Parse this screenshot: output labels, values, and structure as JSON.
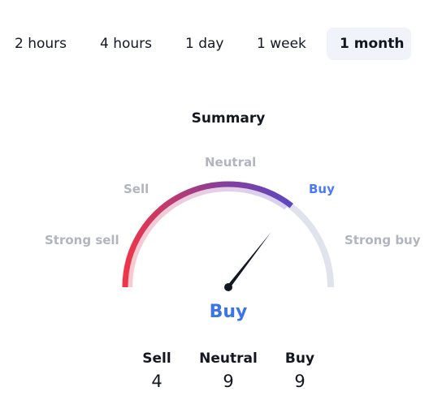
{
  "tabs": [
    {
      "label": "2 hours",
      "active": false
    },
    {
      "label": "4 hours",
      "active": false
    },
    {
      "label": "1 day",
      "active": false
    },
    {
      "label": "1 week",
      "active": false
    },
    {
      "label": "1 month",
      "active": true
    }
  ],
  "summary": {
    "title": "Summary",
    "gauge_labels": {
      "strong_sell": "Strong sell",
      "sell": "Sell",
      "neutral": "Neutral",
      "buy": "Buy",
      "strong_buy": "Strong buy"
    },
    "active_label": "buy",
    "needle_fraction": 0.71,
    "verdict": "Buy",
    "counts": [
      {
        "label": "Sell",
        "value": "4"
      },
      {
        "label": "Neutral",
        "value": "9"
      },
      {
        "label": "Buy",
        "value": "9"
      }
    ],
    "colors": {
      "sell": "#f23645",
      "neutral": "#8c3d96",
      "buy": "#5b48c2",
      "track": "#e0e3eb",
      "verdict": "#3b73e8",
      "needle": "#131722"
    }
  }
}
